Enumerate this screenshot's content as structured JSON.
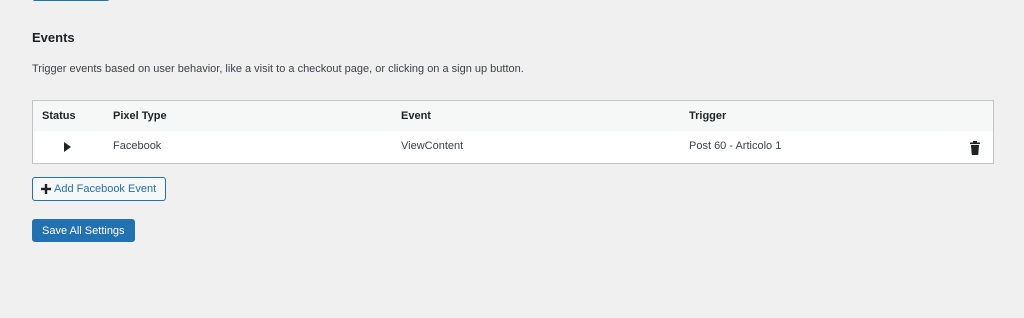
{
  "section": {
    "title": "Events",
    "description": "Trigger events based on user behavior, like a visit to a checkout page, or clicking on a sign up button."
  },
  "table": {
    "columns": [
      "Status",
      "Pixel Type",
      "Event",
      "Trigger"
    ],
    "rows": [
      {
        "status_icon": "play-icon",
        "pixel_type": "Facebook",
        "event": "ViewContent",
        "trigger": "Post 60 - Articolo 1",
        "action_icon": "trash-icon"
      }
    ]
  },
  "buttons": {
    "add_event": "Add Facebook Event",
    "save_all": "Save All Settings"
  },
  "colors": {
    "accent": "#2271b1",
    "background": "#f0f0f1",
    "border": "#c3c4c7"
  }
}
